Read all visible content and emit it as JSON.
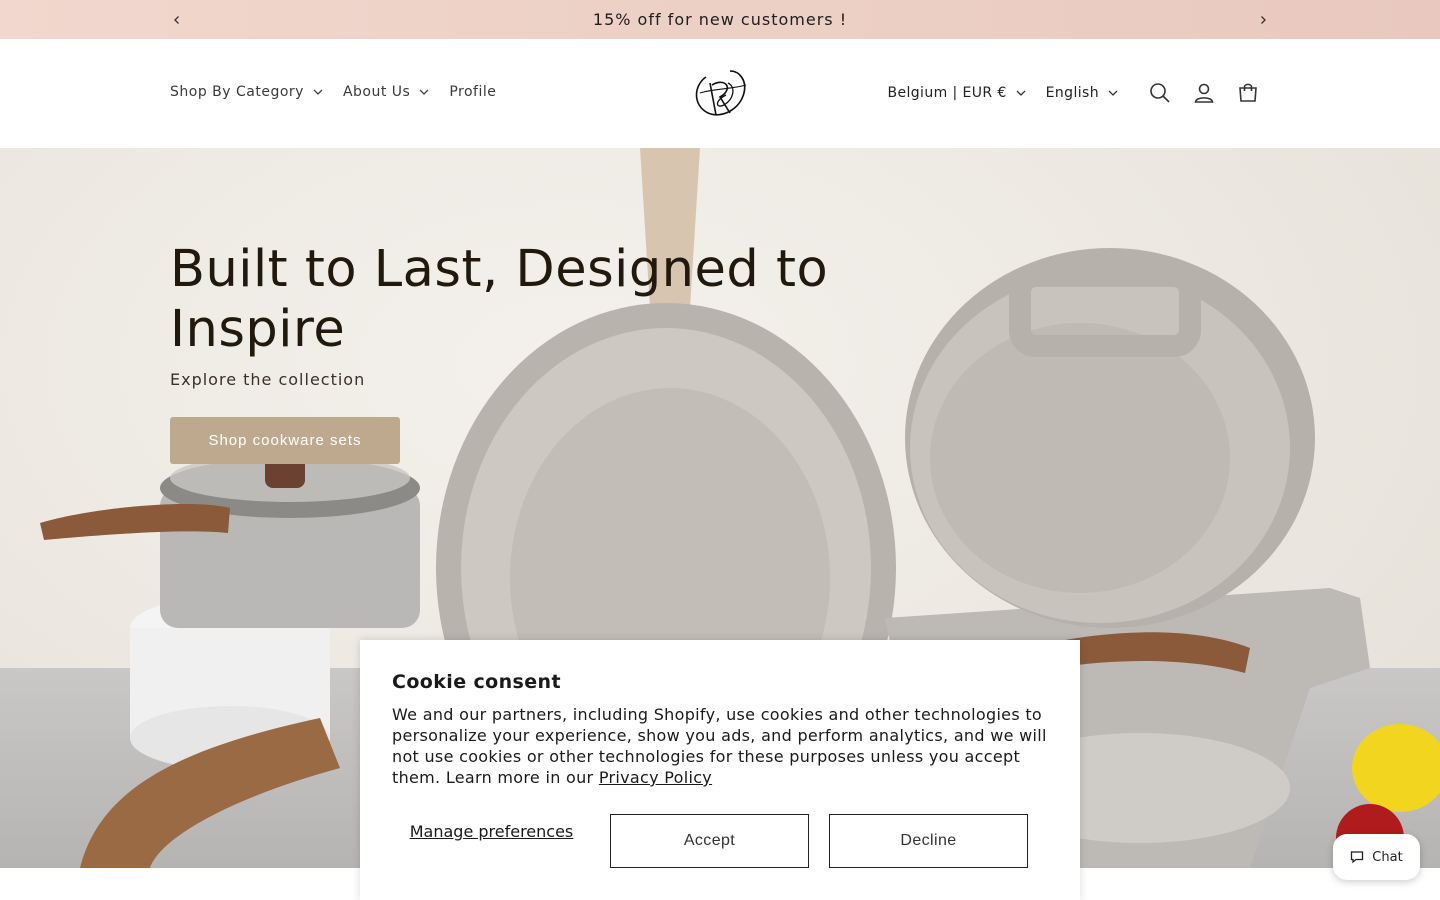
{
  "announcement": {
    "text": "15% off for new customers !"
  },
  "nav": {
    "items": [
      {
        "label": "Shop By Category",
        "has_dropdown": true
      },
      {
        "label": "About Us",
        "has_dropdown": true
      },
      {
        "label": "Profile",
        "has_dropdown": false
      }
    ]
  },
  "header": {
    "country_selector": "Belgium | EUR €",
    "language_selector": "English",
    "icons": [
      "search-icon",
      "account-icon",
      "cart-icon"
    ]
  },
  "hero": {
    "title": "Built to Last, Designed to Inspire",
    "subtitle": "Explore the collection",
    "button_label": "Shop cookware sets"
  },
  "cookie": {
    "title": "Cookie consent",
    "body": "We and our partners, including Shopify, use cookies and other technologies to personalize your experience, show you ads, and perform analytics, and we will not use cookies or other technologies for these purposes unless you accept them. Learn more in our ",
    "link": "Privacy Policy",
    "manage_label": "Manage preferences",
    "accept_label": "Accept",
    "decline_label": "Decline"
  },
  "chat": {
    "label": "Chat"
  },
  "colors": {
    "announcement_bg": "#ecd0c6",
    "hero_button": "#bfa98e",
    "hero_title": "#22190e"
  }
}
